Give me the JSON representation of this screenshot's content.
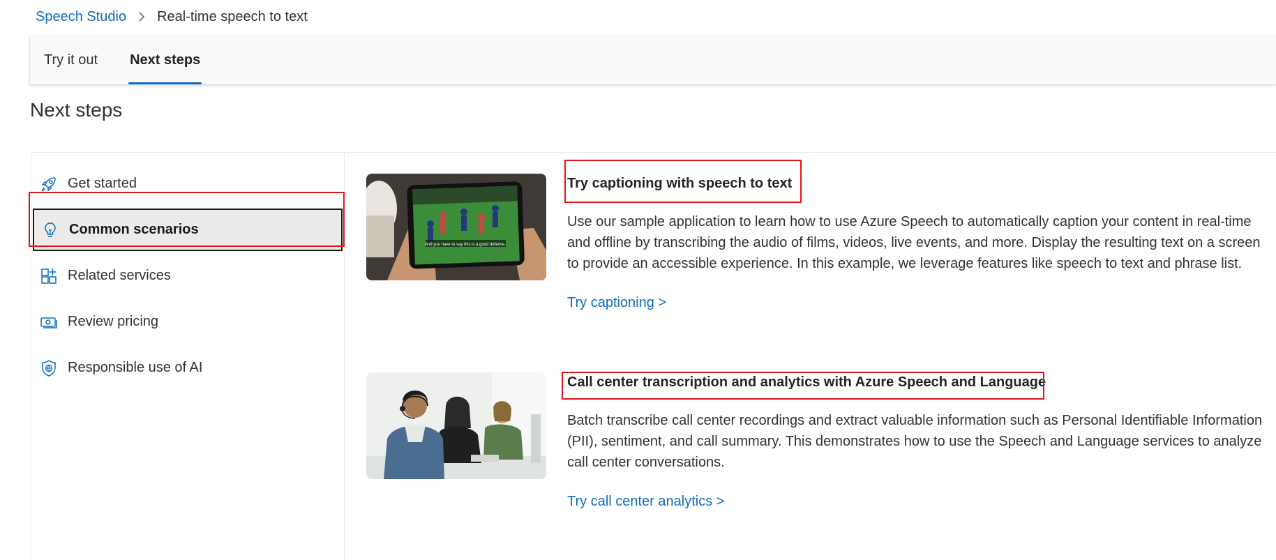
{
  "breadcrumb": {
    "root": "Speech Studio",
    "separator_icon": "chevron-right-icon",
    "current": "Real-time speech to text"
  },
  "tabs": [
    {
      "label": "Try it out",
      "active": false
    },
    {
      "label": "Next steps",
      "active": true
    }
  ],
  "page_title": "Next steps",
  "sidebar": {
    "items": [
      {
        "label": "Get started",
        "icon": "rocket-icon",
        "selected": false
      },
      {
        "label": "Common scenarios",
        "icon": "lightbulb-icon",
        "selected": true
      },
      {
        "label": "Related services",
        "icon": "grid-add-icon",
        "selected": false
      },
      {
        "label": "Review pricing",
        "icon": "money-icon",
        "selected": false
      },
      {
        "label": "Responsible use of AI",
        "icon": "shield-icon",
        "selected": false
      }
    ]
  },
  "cards": [
    {
      "title": "Try captioning with speech to text",
      "description": "Use our sample application to learn how to use Azure Speech to automatically caption your content in real-time and offline by transcribing the audio of films, videos, live events, and more. Display the resulting text on a screen to provide an accessible experience. In this example, we leverage features like speech to text and phrase list.",
      "link": "Try captioning >",
      "image": "phone-soccer-captions-image",
      "caption_overlay": "And you have to say this is a good defense."
    },
    {
      "title": "Call center transcription and analytics with Azure Speech and Language",
      "description": "Batch transcribe call center recordings and extract valuable information such as Personal Identifiable Information (PII), sentiment, and call summary. This demonstrates how to use the Speech and Language services to analyze call center conversations.",
      "link": "Try call center analytics >",
      "image": "call-center-agents-image"
    }
  ],
  "colors": {
    "accent": "#0f6cbd",
    "annotation": "#e3121b",
    "selected_bg": "#edebe9"
  }
}
